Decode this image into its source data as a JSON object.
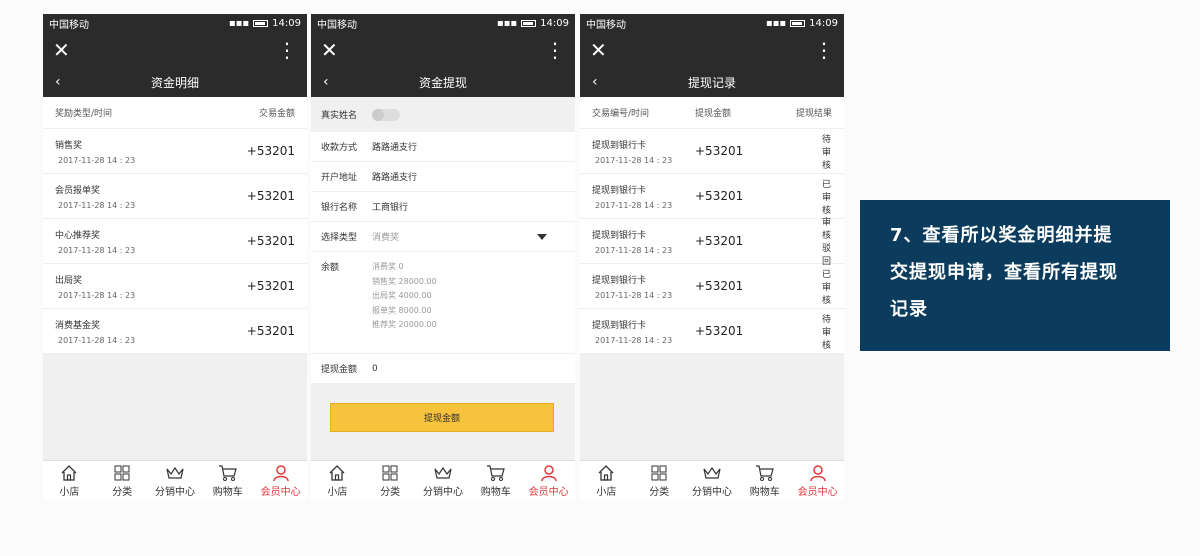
{
  "status": {
    "carrier": "中国移动",
    "time": "14:09"
  },
  "tabbar": [
    {
      "label": "小店",
      "icon": "home-icon"
    },
    {
      "label": "分类",
      "icon": "grid-icon"
    },
    {
      "label": "分销中心",
      "icon": "crown-icon"
    },
    {
      "label": "购物车",
      "icon": "cart-icon"
    },
    {
      "label": "会员中心",
      "icon": "user-icon",
      "active": true
    }
  ],
  "screen1": {
    "title": "资金明细",
    "header": {
      "left": "奖励类型/时间",
      "right": "交易金额"
    },
    "rows": [
      {
        "type": "销售奖",
        "time": "2017-11-28 14 : 23",
        "amount": "+53201"
      },
      {
        "type": "会员报单奖",
        "time": "2017-11-28 14 : 23",
        "amount": "+53201"
      },
      {
        "type": "中心推荐奖",
        "time": "2017-11-28 14 : 23",
        "amount": "+53201"
      },
      {
        "type": "出局奖",
        "time": "2017-11-28 14 : 23",
        "amount": "+53201"
      },
      {
        "type": "消费基金奖",
        "time": "2017-11-28 14 : 23",
        "amount": "+53201"
      }
    ]
  },
  "screen2": {
    "title": "资金提现",
    "real_name_label": "真实姓名",
    "fields": [
      {
        "label": "收款方式",
        "value": "路路通支行"
      },
      {
        "label": "开户地址",
        "value": "路路通支行"
      },
      {
        "label": "银行名称",
        "value": "工商银行"
      }
    ],
    "select": {
      "label": "选择类型",
      "value": "消费奖"
    },
    "balance": {
      "label": "余额",
      "items": [
        "消费奖  0",
        "销售奖 28000.00",
        "出局奖 4000.00",
        "报单奖 8000.00",
        "推荐奖 20000.00"
      ]
    },
    "amount": {
      "label": "提现金额",
      "value": "0"
    },
    "button": "提现金额"
  },
  "screen3": {
    "title": "提现记录",
    "header": {
      "c1": "交易编号/时间",
      "c2": "提现金额",
      "c3": "提现结果"
    },
    "rows": [
      {
        "id": "提现到银行卡",
        "time": "2017-11-28 14 : 23",
        "amount": "+53201",
        "result": "待审核"
      },
      {
        "id": "提现到银行卡",
        "time": "2017-11-28 14 : 23",
        "amount": "+53201",
        "result": "已审核"
      },
      {
        "id": "提现到银行卡",
        "time": "2017-11-28 14 : 23",
        "amount": "+53201",
        "result": "审核驳回"
      },
      {
        "id": "提现到银行卡",
        "time": "2017-11-28 14 : 23",
        "amount": "+53201",
        "result": "已审核"
      },
      {
        "id": "提现到银行卡",
        "time": "2017-11-28 14 : 23",
        "amount": "+53201",
        "result": "待审核"
      }
    ]
  },
  "note": {
    "lines": [
      "7、查看所以奖金明细并提",
      "交提现申请，查看所有提现",
      "记录"
    ]
  },
  "colors": {
    "dark_bar": "#2b2b2b",
    "accent_red": "#e0393e",
    "button_yellow": "#f7c23c",
    "note_bg": "#0b3c5d"
  }
}
